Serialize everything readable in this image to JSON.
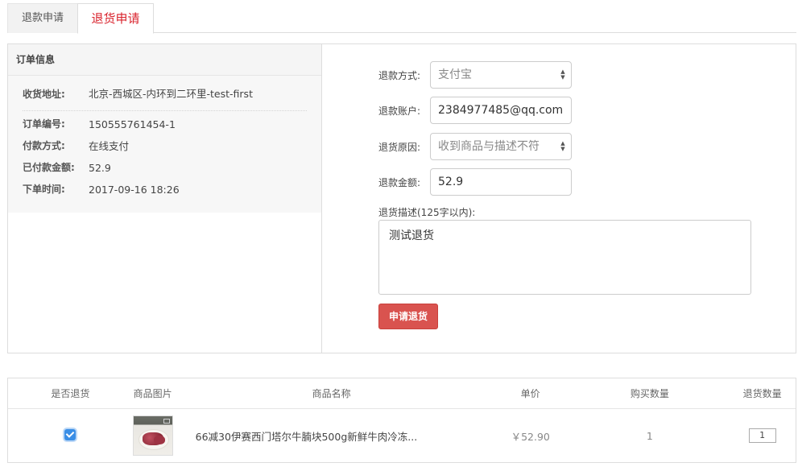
{
  "tabs": [
    {
      "label": "退款申请"
    },
    {
      "label": "退货申请"
    }
  ],
  "order": {
    "title": "订单信息",
    "address_label": "收货地址:",
    "address": "北京-西城区-内环到二环里-test-first",
    "number_label": "订单编号:",
    "number": "150555761454-1",
    "payment_label": "付款方式:",
    "payment": "在线支付",
    "paid_label": "已付款金额:",
    "paid": "52.9",
    "time_label": "下单时间:",
    "time": "2017-09-16 18:26"
  },
  "form": {
    "refund_method_label": "退款方式:",
    "refund_method": "支付宝",
    "account_label": "退款账户:",
    "account": "2384977485@qq.com",
    "reason_label": "退货原因:",
    "reason": "收到商品与描述不符",
    "amount_label": "退款金额:",
    "amount": "52.9",
    "desc_label": "退货描述(125字以内):",
    "desc": "测试退货",
    "submit_label": "申请退货"
  },
  "table": {
    "headers": [
      "是否退货",
      "商品图片",
      "商品名称",
      "单价",
      "购买数量",
      "退货数量"
    ],
    "rows": [
      {
        "checked": true,
        "name": "66减30伊赛西门塔尔牛腩块500g新鲜牛肉冷冻...",
        "price": "￥52.90",
        "quantity": "1",
        "return_qty": "1"
      }
    ]
  }
}
